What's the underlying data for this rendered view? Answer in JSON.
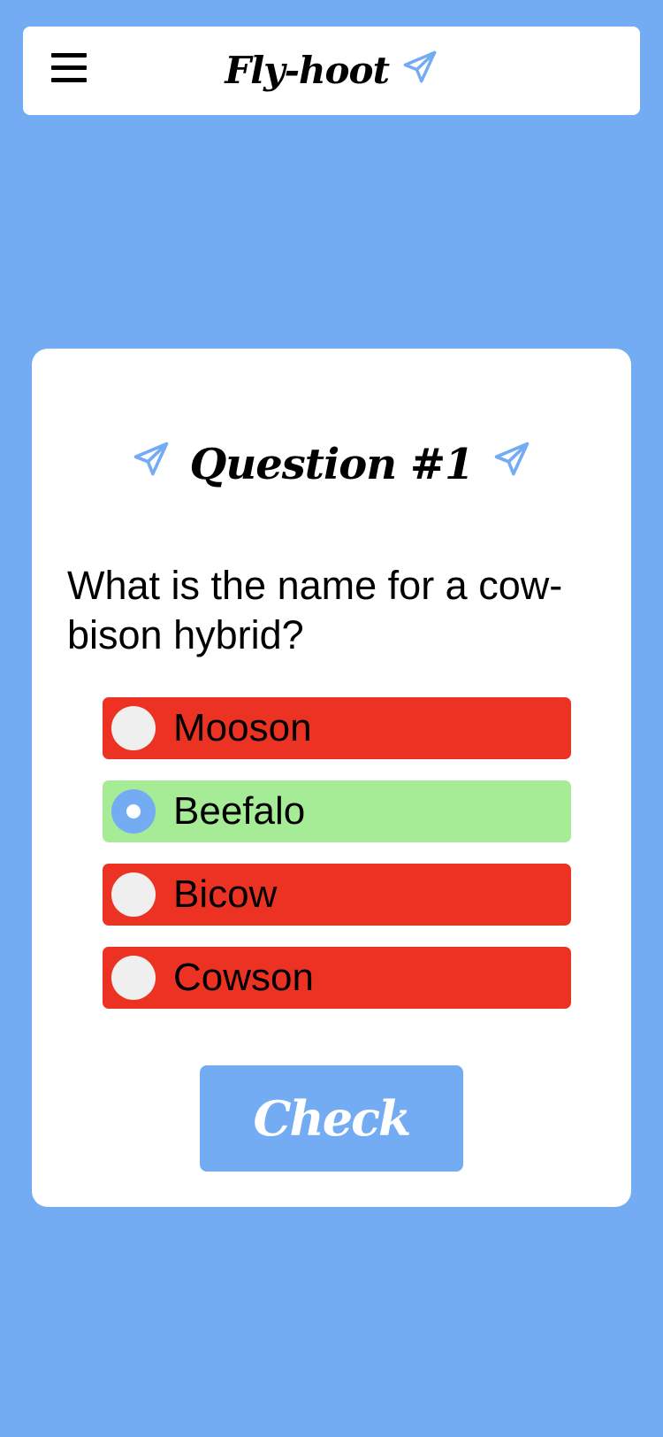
{
  "header": {
    "brand": "Fly-hoot",
    "menu_icon": "hamburger-menu-icon",
    "brand_icon": "paper-plane-icon"
  },
  "quiz": {
    "title": "Question #1",
    "title_icons": [
      "paper-plane-icon",
      "paper-plane-icon"
    ],
    "question": "What is the name for a cow-bison hybrid?",
    "options": [
      {
        "label": "Mooson",
        "state": "wrong",
        "selected": false
      },
      {
        "label": "Beefalo",
        "state": "correct",
        "selected": true
      },
      {
        "label": "Bicow",
        "state": "wrong",
        "selected": false
      },
      {
        "label": "Cowson",
        "state": "wrong",
        "selected": false
      }
    ],
    "check_label": "Check"
  },
  "colors": {
    "background": "#74acf4",
    "accent": "#74acf4",
    "wrong": "#ec3323",
    "correct": "#a6ec97",
    "radio_unselected": "#efefef"
  }
}
